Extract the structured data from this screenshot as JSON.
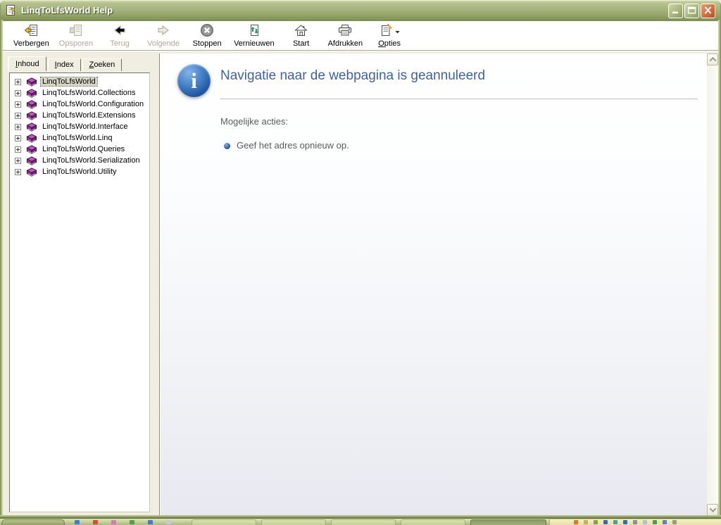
{
  "window": {
    "title": "LinqToLfsWorld Help",
    "icon": "chm-help-file-icon",
    "controls": [
      {
        "id": "minimize",
        "icon": "minimize-icon"
      },
      {
        "id": "maximize",
        "icon": "maximize-icon"
      },
      {
        "id": "close",
        "icon": "close-icon"
      }
    ]
  },
  "toolbar": {
    "buttons": [
      {
        "id": "verbergen",
        "label": "Verbergen",
        "icon": "hide-pane-icon",
        "enabled": true
      },
      {
        "id": "opsporen",
        "label": "Opsporen",
        "icon": "locate-icon",
        "enabled": false
      },
      {
        "id": "terug",
        "label": "Terug",
        "icon": "back-arrow-icon",
        "enabled": false
      },
      {
        "id": "volgende",
        "label": "Volgende",
        "icon": "forward-arrow-icon",
        "enabled": false
      },
      {
        "id": "stoppen",
        "label": "Stoppen",
        "icon": "stop-icon",
        "enabled": true
      },
      {
        "id": "vernieuwen",
        "label": "Vernieuwen",
        "icon": "refresh-icon",
        "enabled": true
      },
      {
        "id": "start",
        "label": "Start",
        "icon": "home-icon",
        "enabled": true
      },
      {
        "id": "afdrukken",
        "label": "Afdrukken",
        "icon": "print-icon",
        "enabled": true
      },
      {
        "id": "opties",
        "label": "Opties",
        "icon": "options-icon",
        "enabled": true,
        "accel_index": 0,
        "has_dropdown": true,
        "dropdown_icon": "dropdown-arrow-icon"
      }
    ]
  },
  "tabs": [
    {
      "id": "inhoud",
      "label": "Inhoud",
      "accel_index": 0,
      "active": true
    },
    {
      "id": "index",
      "label": "Index",
      "accel_index": 0,
      "active": false
    },
    {
      "id": "zoeken",
      "label": "Zoeken",
      "accel_index": 0,
      "active": false
    }
  ],
  "tree": {
    "item_icon": "closed-book-icon",
    "expand_icon": "plus-box-icon",
    "items": [
      {
        "label": "LinqToLfsWorld",
        "selected": true
      },
      {
        "label": "LinqToLfsWorld.Collections",
        "selected": false
      },
      {
        "label": "LinqToLfsWorld.Configuration",
        "selected": false
      },
      {
        "label": "LinqToLfsWorld.Extensions",
        "selected": false
      },
      {
        "label": "LinqToLfsWorld.Interface",
        "selected": false
      },
      {
        "label": "LinqToLfsWorld.Linq",
        "selected": false
      },
      {
        "label": "LinqToLfsWorld.Queries",
        "selected": false
      },
      {
        "label": "LinqToLfsWorld.Serialization",
        "selected": false
      },
      {
        "label": "LinqToLfsWorld.Utility",
        "selected": false
      }
    ]
  },
  "content": {
    "icon": "info-icon",
    "icon_glyph": "i",
    "heading": "Navigatie naar de webpagina is geannuleerd",
    "possible_actions_label": "Mogelijke acties:",
    "actions": [
      "Geef het adres opnieuw op."
    ]
  },
  "scrollbar": {
    "up_icon": "chevron-up-icon",
    "down_icon": "chevron-down-icon"
  },
  "taskbar": {
    "quick_launch_icons": [
      "#4a7ac0",
      "#d05030",
      "#d080b0",
      "#50a050",
      "#4a7ac0",
      "#c8c8dc"
    ],
    "window_buttons": [
      {
        "active": false
      },
      {
        "active": false
      },
      {
        "active": false
      },
      {
        "active": false
      },
      {
        "active": true
      }
    ],
    "tray_icons": [
      "#e07820",
      "#c8b060",
      "#88a040",
      "#3868b8",
      "#48a0a0",
      "#3868b8",
      "#8890a0",
      "#b0c0d8",
      "#48a048",
      "#6080c0",
      "#9a9a8c"
    ]
  },
  "colors": {
    "titlebar_olive": "#a5b37d",
    "close_button_orange": "#c85a33",
    "heading_blue": "#41629a",
    "book_purple": "#993399",
    "selection_gray": "#d6d6c6",
    "content_fade_bottom": "#e8e9f0",
    "body_text_gray": "#5a5a5a",
    "taskbar_olive": "#c4cf98"
  }
}
